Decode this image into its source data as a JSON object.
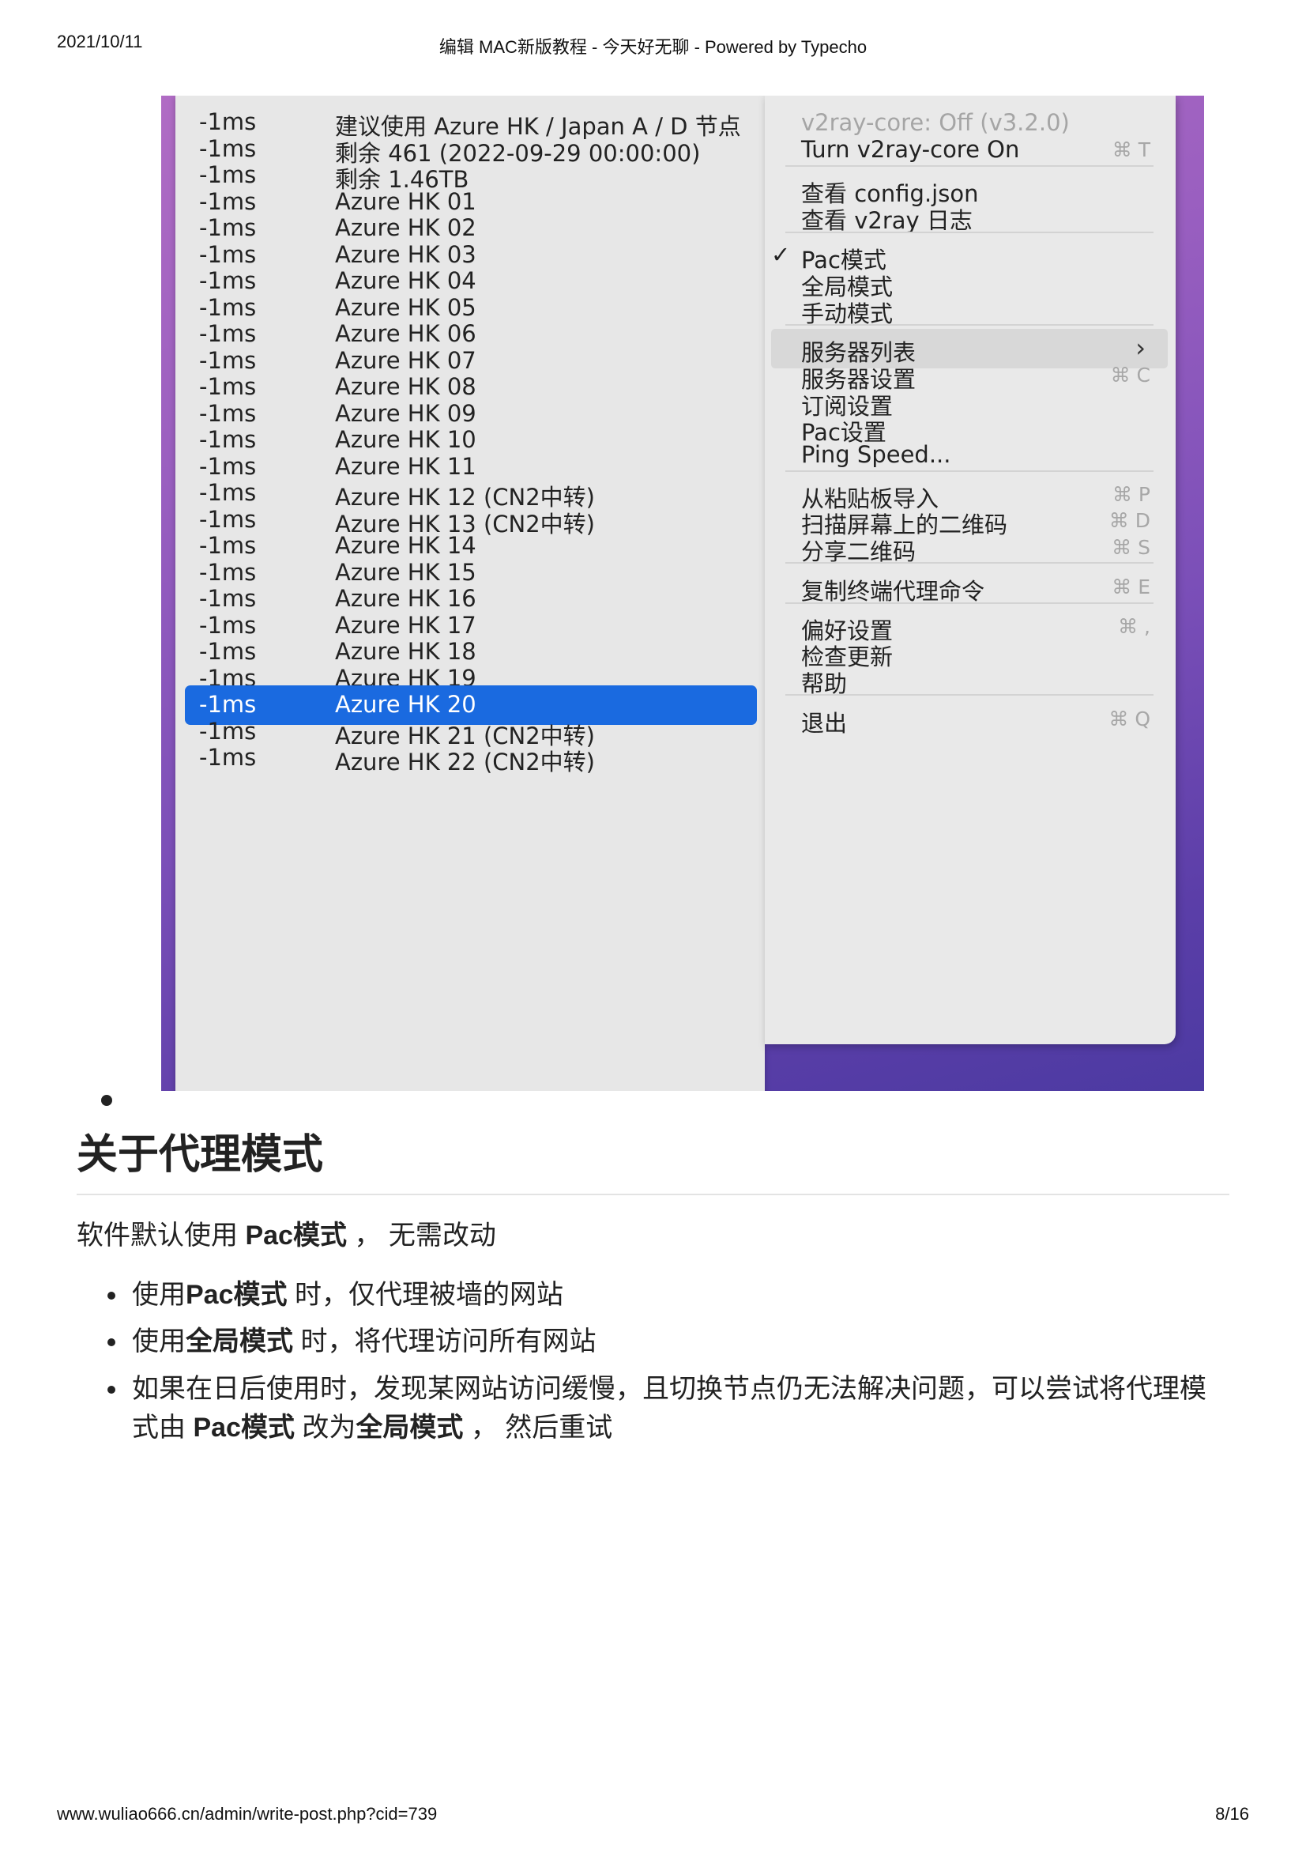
{
  "header": {
    "date": "2021/10/11",
    "title": "编辑 MAC新版教程 - 今天好无聊 - Powered by Typecho"
  },
  "footer": {
    "url": "www.wuliao666.cn/admin/write-post.php?cid=739",
    "page": "8/16"
  },
  "server_list": [
    {
      "latency": "-1ms",
      "name": "建议使用 Azure HK / Japan A / D 节点"
    },
    {
      "latency": "-1ms",
      "name": "剩余 461 (2022-09-29 00:00:00)"
    },
    {
      "latency": "-1ms",
      "name": "剩余 1.46TB"
    },
    {
      "latency": "-1ms",
      "name": "Azure HK 01"
    },
    {
      "latency": "-1ms",
      "name": "Azure HK 02"
    },
    {
      "latency": "-1ms",
      "name": "Azure HK 03"
    },
    {
      "latency": "-1ms",
      "name": "Azure HK 04"
    },
    {
      "latency": "-1ms",
      "name": "Azure HK 05"
    },
    {
      "latency": "-1ms",
      "name": "Azure HK 06"
    },
    {
      "latency": "-1ms",
      "name": "Azure HK 07"
    },
    {
      "latency": "-1ms",
      "name": "Azure HK 08"
    },
    {
      "latency": "-1ms",
      "name": "Azure HK 09"
    },
    {
      "latency": "-1ms",
      "name": "Azure HK 10"
    },
    {
      "latency": "-1ms",
      "name": "Azure HK 11"
    },
    {
      "latency": "-1ms",
      "name": "Azure HK 12 (CN2中转)"
    },
    {
      "latency": "-1ms",
      "name": "Azure HK 13 (CN2中转)"
    },
    {
      "latency": "-1ms",
      "name": "Azure HK 14"
    },
    {
      "latency": "-1ms",
      "name": "Azure HK 15"
    },
    {
      "latency": "-1ms",
      "name": "Azure HK 16"
    },
    {
      "latency": "-1ms",
      "name": "Azure HK 17"
    },
    {
      "latency": "-1ms",
      "name": "Azure HK 18"
    },
    {
      "latency": "-1ms",
      "name": "Azure HK 19"
    },
    {
      "latency": "-1ms",
      "name": "Azure HK 20",
      "selected": true
    },
    {
      "latency": "-1ms",
      "name": "Azure HK 21 (CN2中转)"
    },
    {
      "latency": "-1ms",
      "name": "Azure HK 22 (CN2中转)"
    }
  ],
  "main_menu": {
    "items": [
      {
        "label": "v2ray-core: Off  (v3.2.0)",
        "disabled": true
      },
      {
        "label": "Turn v2ray-core On",
        "shortcut": "⌘ T"
      },
      {
        "label": "查看 config.json"
      },
      {
        "label": "查看 v2ray 日志"
      },
      {
        "label": "Pac模式",
        "checked": true
      },
      {
        "label": "全局模式"
      },
      {
        "label": "手动模式"
      },
      {
        "label": "服务器列表",
        "submenu": true,
        "highlighted": true
      },
      {
        "label": "服务器设置",
        "shortcut": "⌘ C"
      },
      {
        "label": "订阅设置"
      },
      {
        "label": "Pac设置"
      },
      {
        "label": "Ping Speed..."
      },
      {
        "label": "从粘贴板导入",
        "shortcut": "⌘ P"
      },
      {
        "label": "扫描屏幕上的二维码",
        "shortcut": "⌘ D"
      },
      {
        "label": "分享二维码",
        "shortcut": "⌘ S"
      },
      {
        "label": "复制终端代理命令",
        "shortcut": "⌘ E"
      },
      {
        "label": "偏好设置",
        "shortcut": "⌘ ,"
      },
      {
        "label": "检查更新"
      },
      {
        "label": "帮助"
      },
      {
        "label": "退出",
        "shortcut": "⌘ Q"
      }
    ],
    "check_glyph": "✓",
    "submenu_glyph": "›"
  },
  "article": {
    "heading": "关于代理模式",
    "intro": [
      {
        "t": "软件默认使用 "
      },
      {
        "t": "Pac模式",
        "b": true
      },
      {
        "t": " ， 无需改动"
      }
    ],
    "bullets": [
      [
        {
          "t": "使用"
        },
        {
          "t": "Pac模式",
          "b": true
        },
        {
          "t": " 时，仅代理被墙的网站"
        }
      ],
      [
        {
          "t": "使用"
        },
        {
          "t": "全局模式",
          "b": true
        },
        {
          "t": " 时，将代理访问所有网站"
        }
      ],
      [
        {
          "t": "如果在日后使用时，发现某网站访问缓慢，且切换节点仍无法解决问题，可以尝试将代理模式由 "
        },
        {
          "t": "Pac模式",
          "b": true
        },
        {
          "t": " 改为"
        },
        {
          "t": "全局模式",
          "b": true
        },
        {
          "t": " ， 然后重试"
        }
      ]
    ]
  }
}
